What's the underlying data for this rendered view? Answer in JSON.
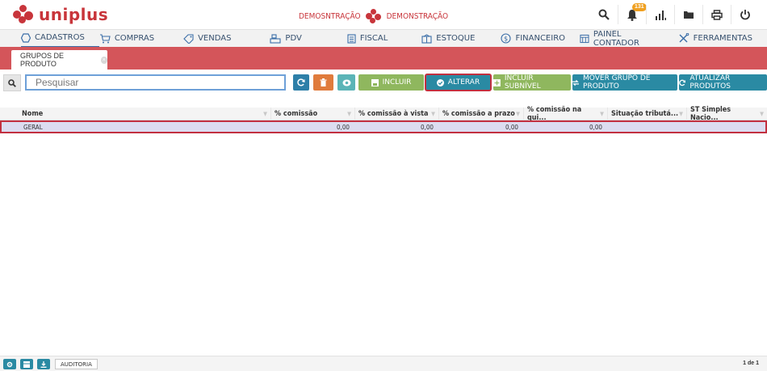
{
  "app": {
    "logo_text": "uniplus",
    "company": [
      "DEMOSNTRAÇÃO",
      "DEMONSTRAÇÃO"
    ],
    "brand_color": "#c8353b"
  },
  "top_icons": [
    {
      "name": "search-icon"
    },
    {
      "name": "bell-icon",
      "badge": "131"
    },
    {
      "name": "bar-chart-icon"
    },
    {
      "name": "folder-icon"
    },
    {
      "name": "print-icon"
    },
    {
      "name": "power-icon"
    }
  ],
  "menu": [
    {
      "label": "CADASTROS",
      "icon": "hexagon-icon",
      "active": true
    },
    {
      "label": "COMPRAS",
      "icon": "cart-icon"
    },
    {
      "label": "VENDAS",
      "icon": "tag-icon"
    },
    {
      "label": "PDV",
      "icon": "register-icon"
    },
    {
      "label": "FISCAL",
      "icon": "document-icon"
    },
    {
      "label": "ESTOQUE",
      "icon": "box-icon"
    },
    {
      "label": "FINANCEIRO",
      "icon": "dollar-icon"
    },
    {
      "label": "PAINEL CONTADOR",
      "icon": "calculator-icon"
    },
    {
      "label": "FERRAMENTAS",
      "icon": "tools-icon"
    }
  ],
  "tab": {
    "label": "GRUPOS DE PRODUTO"
  },
  "search": {
    "placeholder": "Pesquisar"
  },
  "buttons": {
    "incluir": "INCLUIR",
    "alterar": "ALTERAR",
    "incluir_subnivel": "INCLUIR SUBNÍVEL",
    "mover": "MOVER GRUPO DE PRODUTO",
    "atualizar": "ATUALIZAR PRODUTOS"
  },
  "grid": {
    "columns": [
      "Nome",
      "% comissão",
      "% comissão à vista",
      "% comissão a prazo",
      "% comissão na qui...",
      "Situação tributá...",
      "ST Simples Nacio..."
    ],
    "rows": [
      {
        "nome": "GERAL",
        "comissao": "0,00",
        "vista": "0,00",
        "prazo": "0,00",
        "qui": "0,00",
        "situacao": "",
        "st": ""
      }
    ]
  },
  "footer": {
    "audit_label": "AUDITORIA",
    "pager": "1 de 1"
  }
}
